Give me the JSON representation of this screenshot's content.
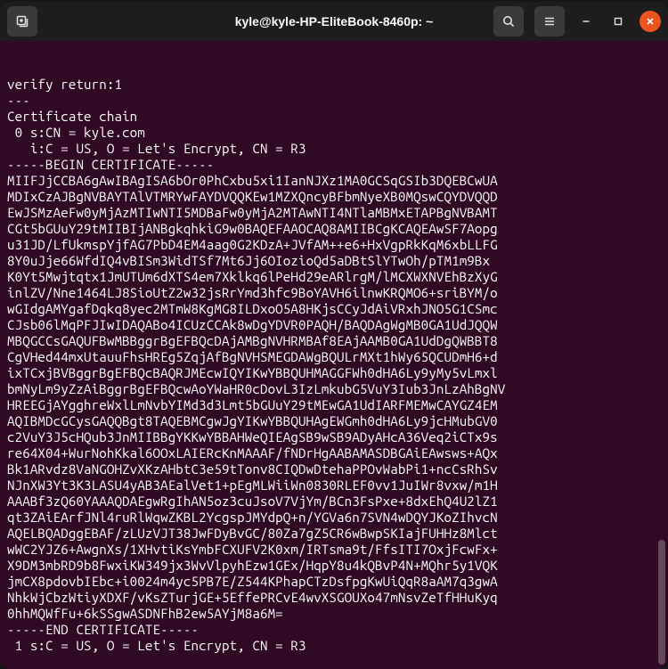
{
  "window": {
    "title": "kyle@kyle-HP-EliteBook-8460p: ~"
  },
  "terminal": {
    "lines": [
      "verify return:1",
      "---",
      "Certificate chain",
      " 0 s:CN = kyle.com",
      "   i:C = US, O = Let's Encrypt, CN = R3",
      "-----BEGIN CERTIFICATE-----",
      "MIIFJjCCBA6gAwIBAgISA6bOr0PhCxbu5xi1IanNJXz1MA0GCSqGSIb3DQEBCwUA",
      "MDIxCzAJBgNVBAYTAlVTMRYwFAYDVQQKEw1MZXQncyBFbmNyeXB0MQswCQYDVQQD",
      "EwJSMzAeFw0yMjAzMTIwNTI5MDBaFw0yMjA2MTAwNTI4NTlaMBMxETAPBgNVBAMT",
      "CGt5bGUuY29tMIIBIjANBgkqhkiG9w0BAQEFAAOCAQ8AMIIBCgKCAQEAwSF7Aopg",
      "u31JD/LfUkmspYjfAG7PbD4EM4aag0G2KDzA+JVfAM++e6+HxVgpRkKqM6xbLLFG",
      "8Y0uJje66WfdIQ4vBISm3WidTSf7Mt6Jj6OIozioQd5aDBtSlYTwOh/pTM1m9Bx",
      "K0Yt5Mwjtqtx1JmUTUm6dXTS4em7Xklkq6lPeHd29eARlrgM/lMCXWXNVEhBzXyG",
      "inlZV/Nne1464LJ8SioUtZ2w32jsRrYmd3hfc9BoYAVH6ilnwKRQMO6+sriBYM/o",
      "wGIdgAMYgafDqkq8yec2MTmW8KgMG8ILDxoO5A8HKjsCCyJdAiVRxhJNO5G1CSmc",
      "CJsb06lMqPFJIwIDAQABo4ICUzCCAk8wDgYDVR0PAQH/BAQDAgWgMB0GA1UdJQQW",
      "MBQGCCsGAQUFBwMBBggrBgEFBQcDAjAMBgNVHRMBAf8EAjAAMB0GA1UdDgQWBBT8",
      "CgVHed44mxUtauuFhsHREg5ZqjAfBgNVHSMEGDAWgBQULrMXt1hWy65QCUDmH6+d",
      "ixTCxjBVBggrBgEFBQcBAQRJMEcwIQYIKwYBBQUHMAGGFWh0dHA6Ly9yMy5vLmxl",
      "bmNyLm9yZzAiBggrBgEFBQcwAoYWaHR0cDovL3IzLmkubG5VuY3Iub3JnLzAhBgNV",
      "HREEGjAYgghreWxlLmNvbYIMd3d3Lmt5bGUuY29tMEwGA1UdIARFMEMwCAYGZ4EM",
      "AQIBMDcGCysGAQQBgt8TAQEBMCgwJgYIKwYBBQUHAgEWGmh0dHA6Ly9jcHMubGV0",
      "c2VuY3J5cHQub3JnMIIBBgYKKwYBBAHWeQIEAgSB9wSB9ADyAHcA36Veq2iCTx9s",
      "re64X04+WurNohKkal6OOxLAIERcKnMAAAF/fNDrHgAABAMASDBGAiEAwsws+AQx",
      "Bk1ARvdz8VaNGOHZvXKzAHbtC3e59tTonv8CIQDwDtehaPPOvWabPi1+ncCsRhSv",
      "NJnXW3Yt3K3LASU4yAB3AEalVet1+pEgMLWiiWn0830RLEF0vv1JuIWr8vxw/m1H",
      "AAABf3zQ60YAAAQDAEgwRgIhAN5oz3cuJsoV7VjYm/BCn3FsPxe+8dxEhQ4U2lZ1",
      "qt3ZAiEArfJNl4ruRlWqwZKBL2YcgspJMYdpQ+n/YGVa6n7SVN4wDQYJKoZIhvcN",
      "AQELBQADggEBAF/zLUzVJT38JwFDyBvGC/80Za7gZ5CR6wBwpSKIajFUHHz8Mlct",
      "wWC2YJZ6+AwgnXs/1XHvtiKsYmbFCXUFV2K0xm/IRTsma9t/FfsITI7OxjFcwFx+",
      "X9DM3mbRD9b8FwxiKW349jx3WvVlpyhEzw1GEx/HqpY8u4kQBvP4N+MQhr5y1VQK",
      "jmCX8pdovbIEbc+i0024m4yc5PB7E/Z544KPhapCTzDsfpgKwUiQqR8aAM7q3gwA",
      "NhkWjCbzWtiyXDXF/vKsZTurjGE+5EffePRCvE4wvXSGOUXo47mNsvZeTfHHuKyq",
      "0hhMQWfFu+6kSSgwASDNFhB2ew5AYjM8a6M=",
      "-----END CERTIFICATE-----",
      " 1 s:C = US, O = Let's Encrypt, CN = R3"
    ]
  }
}
